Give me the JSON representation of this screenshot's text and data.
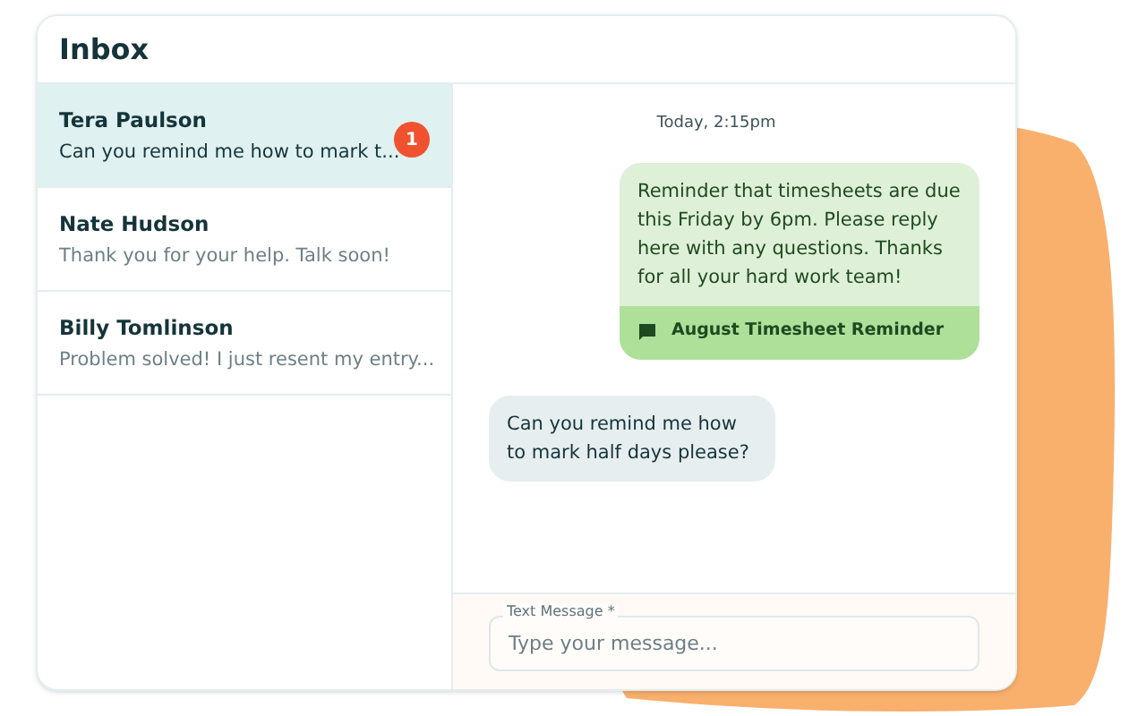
{
  "title": "Inbox",
  "conversations": [
    {
      "name": "Tera Paulson",
      "preview": "Can you remind me how to mark t...",
      "unread": "1",
      "selected": true
    },
    {
      "name": "Nate Hudson",
      "preview": "Thank you for your help. Talk soon!",
      "selected": false
    },
    {
      "name": "Billy Tomlinson",
      "preview": "Problem solved! I just resent my entry...",
      "selected": false
    }
  ],
  "timestamp": "Today, 2:15pm",
  "messages": [
    {
      "kind": "outgoing",
      "text": "Reminder that timesheets are due this Friday by 6pm. Please reply here with any questions. Thanks for all your hard work team!",
      "campaign": "August Timesheet Reminder"
    },
    {
      "kind": "incoming",
      "text": "Can you remind me how to mark half days please?"
    }
  ],
  "composer": {
    "label": "Text Message *",
    "placeholder": "Type your message..."
  }
}
